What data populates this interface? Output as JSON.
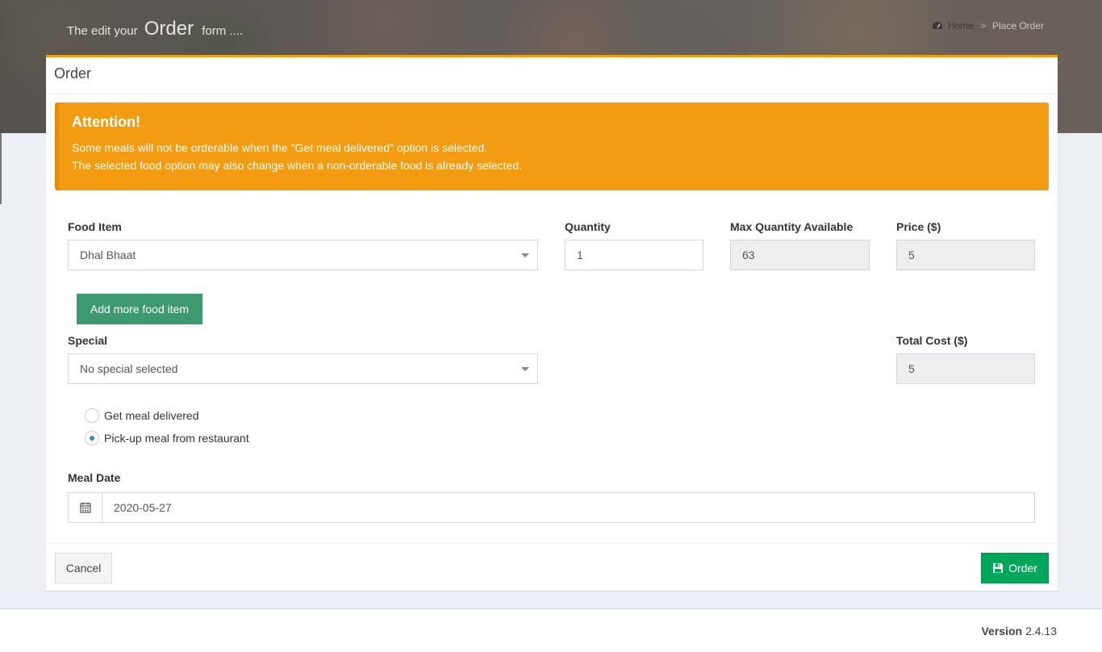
{
  "header": {
    "heading_prefix": "The edit your",
    "heading_big": "Order",
    "heading_suffix": "form ....",
    "breadcrumb": {
      "home": "Home",
      "separator": ">",
      "current": "Place Order"
    }
  },
  "box": {
    "title": "Order",
    "accent_color": "#f39c12"
  },
  "alert": {
    "title": "Attention!",
    "line1": "Some meals will not be orderable when the \"Get meal delivered\" option is selected.",
    "line2": "The selected food option may also change when a non-orderable food is already selected."
  },
  "form": {
    "food_item": {
      "label": "Food Item",
      "value": "Dhal Bhaat"
    },
    "quantity": {
      "label": "Quantity",
      "value": "1"
    },
    "max_quantity": {
      "label": "Max Quantity Available",
      "value": "63"
    },
    "price": {
      "label": "Price ($)",
      "value": "5"
    },
    "add_more_label": "Add more food item",
    "special": {
      "label": "Special",
      "value": "No special selected"
    },
    "total_cost": {
      "label": "Total Cost ($)",
      "value": "5"
    },
    "delivery_options": [
      {
        "label": "Get meal delivered",
        "selected": false
      },
      {
        "label": "Pick-up meal from restaurant",
        "selected": true
      }
    ],
    "meal_date": {
      "label": "Meal Date",
      "value": "2020-05-27"
    }
  },
  "buttons": {
    "cancel": "Cancel",
    "order": "Order"
  },
  "footer": {
    "version_label": "Version",
    "version_value": "2.4.13"
  },
  "icons": {
    "breadcrumb_home": "dashboard-icon",
    "date": "calendar-icon",
    "order": "save-icon"
  }
}
